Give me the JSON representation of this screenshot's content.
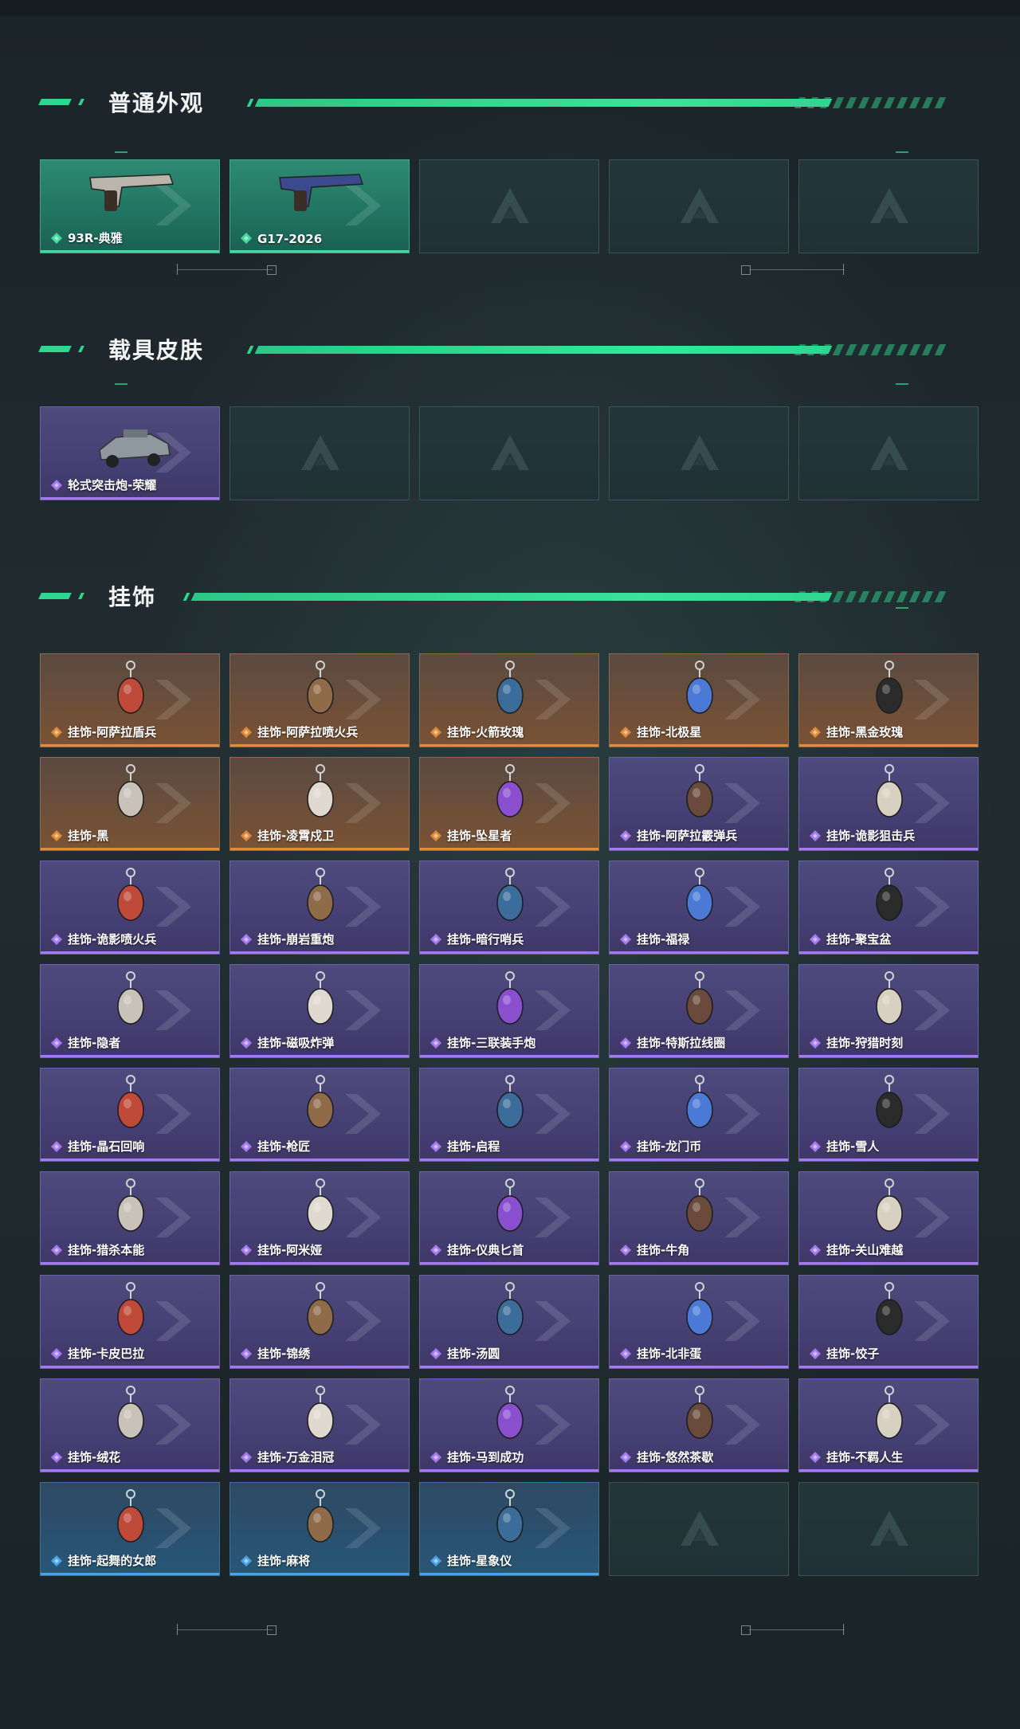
{
  "sections": [
    {
      "title": "普通外观",
      "items": [
        {
          "label": "93R-典雅",
          "rarity": "green",
          "icon": "pistol-icon"
        },
        {
          "label": "G17-2026",
          "rarity": "green",
          "icon": "pistol-icon"
        },
        {
          "label": "",
          "rarity": "empty",
          "icon": "placeholder-logo-icon"
        },
        {
          "label": "",
          "rarity": "empty",
          "icon": "placeholder-logo-icon"
        },
        {
          "label": "",
          "rarity": "empty",
          "icon": "placeholder-logo-icon"
        }
      ]
    },
    {
      "title": "载具皮肤",
      "items": [
        {
          "label": "轮式突击炮-荣耀",
          "rarity": "purple",
          "icon": "vehicle-icon"
        },
        {
          "label": "",
          "rarity": "empty",
          "icon": "placeholder-logo-icon"
        },
        {
          "label": "",
          "rarity": "empty",
          "icon": "placeholder-logo-icon"
        },
        {
          "label": "",
          "rarity": "empty",
          "icon": "placeholder-logo-icon"
        },
        {
          "label": "",
          "rarity": "empty",
          "icon": "placeholder-logo-icon"
        }
      ]
    },
    {
      "title": "挂饰",
      "items": [
        {
          "label": "挂饰-阿萨拉盾兵",
          "rarity": "orange",
          "icon": "charm-icon"
        },
        {
          "label": "挂饰-阿萨拉喷火兵",
          "rarity": "orange",
          "icon": "charm-icon"
        },
        {
          "label": "挂饰-火箭玫瑰",
          "rarity": "orange",
          "icon": "charm-icon"
        },
        {
          "label": "挂饰-北极星",
          "rarity": "orange",
          "icon": "charm-icon"
        },
        {
          "label": "挂饰-黑金玫瑰",
          "rarity": "orange",
          "icon": "charm-icon"
        },
        {
          "label": "挂饰-黑",
          "rarity": "orange",
          "icon": "charm-icon"
        },
        {
          "label": "挂饰-凌霄戍卫",
          "rarity": "orange",
          "icon": "charm-icon"
        },
        {
          "label": "挂饰-坠星者",
          "rarity": "orange",
          "icon": "charm-icon"
        },
        {
          "label": "挂饰-阿萨拉霰弹兵",
          "rarity": "purple",
          "icon": "charm-icon"
        },
        {
          "label": "挂饰-诡影狙击兵",
          "rarity": "purple",
          "icon": "charm-icon"
        },
        {
          "label": "挂饰-诡影喷火兵",
          "rarity": "purple",
          "icon": "charm-icon"
        },
        {
          "label": "挂饰-崩岩重炮",
          "rarity": "purple",
          "icon": "charm-icon"
        },
        {
          "label": "挂饰-暗行哨兵",
          "rarity": "purple",
          "icon": "charm-icon"
        },
        {
          "label": "挂饰-福禄",
          "rarity": "purple",
          "icon": "charm-icon"
        },
        {
          "label": "挂饰-聚宝盆",
          "rarity": "purple",
          "icon": "charm-icon"
        },
        {
          "label": "挂饰-隐者",
          "rarity": "purple",
          "icon": "charm-icon"
        },
        {
          "label": "挂饰-磁吸炸弹",
          "rarity": "purple",
          "icon": "charm-icon"
        },
        {
          "label": "挂饰-三联装手炮",
          "rarity": "purple",
          "icon": "charm-icon"
        },
        {
          "label": "挂饰-特斯拉线圈",
          "rarity": "purple",
          "icon": "charm-icon"
        },
        {
          "label": "挂饰-狩猎时刻",
          "rarity": "purple",
          "icon": "charm-icon"
        },
        {
          "label": "挂饰-晶石回响",
          "rarity": "purple",
          "icon": "charm-icon"
        },
        {
          "label": "挂饰-枪匠",
          "rarity": "purple",
          "icon": "charm-icon"
        },
        {
          "label": "挂饰-启程",
          "rarity": "purple",
          "icon": "charm-icon"
        },
        {
          "label": "挂饰-龙门币",
          "rarity": "purple",
          "icon": "charm-icon"
        },
        {
          "label": "挂饰-雪人",
          "rarity": "purple",
          "icon": "charm-icon"
        },
        {
          "label": "挂饰-猎杀本能",
          "rarity": "purple",
          "icon": "charm-icon"
        },
        {
          "label": "挂饰-阿米娅",
          "rarity": "purple",
          "icon": "charm-icon"
        },
        {
          "label": "挂饰-仪典匕首",
          "rarity": "purple",
          "icon": "charm-icon"
        },
        {
          "label": "挂饰-牛角",
          "rarity": "purple",
          "icon": "charm-icon"
        },
        {
          "label": "挂饰-关山难越",
          "rarity": "purple",
          "icon": "charm-icon"
        },
        {
          "label": "挂饰-卡皮巴拉",
          "rarity": "purple",
          "icon": "charm-icon"
        },
        {
          "label": "挂饰-锦绣",
          "rarity": "purple",
          "icon": "charm-icon"
        },
        {
          "label": "挂饰-汤圆",
          "rarity": "purple",
          "icon": "charm-icon"
        },
        {
          "label": "挂饰-北非蛋",
          "rarity": "purple",
          "icon": "charm-icon"
        },
        {
          "label": "挂饰-饺子",
          "rarity": "purple",
          "icon": "charm-icon"
        },
        {
          "label": "挂饰-绒花",
          "rarity": "purple",
          "icon": "charm-icon"
        },
        {
          "label": "挂饰-万金泪冠",
          "rarity": "purple",
          "icon": "charm-icon"
        },
        {
          "label": "挂饰-马到成功",
          "rarity": "purple",
          "icon": "charm-icon"
        },
        {
          "label": "挂饰-悠然茶歇",
          "rarity": "purple",
          "icon": "charm-icon"
        },
        {
          "label": "挂饰-不羁人生",
          "rarity": "purple",
          "icon": "charm-icon"
        },
        {
          "label": "挂饰-起舞的女郎",
          "rarity": "blue",
          "icon": "charm-icon"
        },
        {
          "label": "挂饰-麻将",
          "rarity": "blue",
          "icon": "charm-icon"
        },
        {
          "label": "挂饰-星象仪",
          "rarity": "blue",
          "icon": "charm-icon"
        },
        {
          "label": "",
          "rarity": "empty",
          "icon": "placeholder-logo-icon"
        },
        {
          "label": "",
          "rarity": "empty",
          "icon": "placeholder-logo-icon"
        }
      ]
    }
  ],
  "colors": {
    "accent": "#2fd68f",
    "green": "#46d6a0",
    "purple": "#a57af0",
    "orange": "#e08b3a",
    "blue": "#4aa3e6"
  }
}
